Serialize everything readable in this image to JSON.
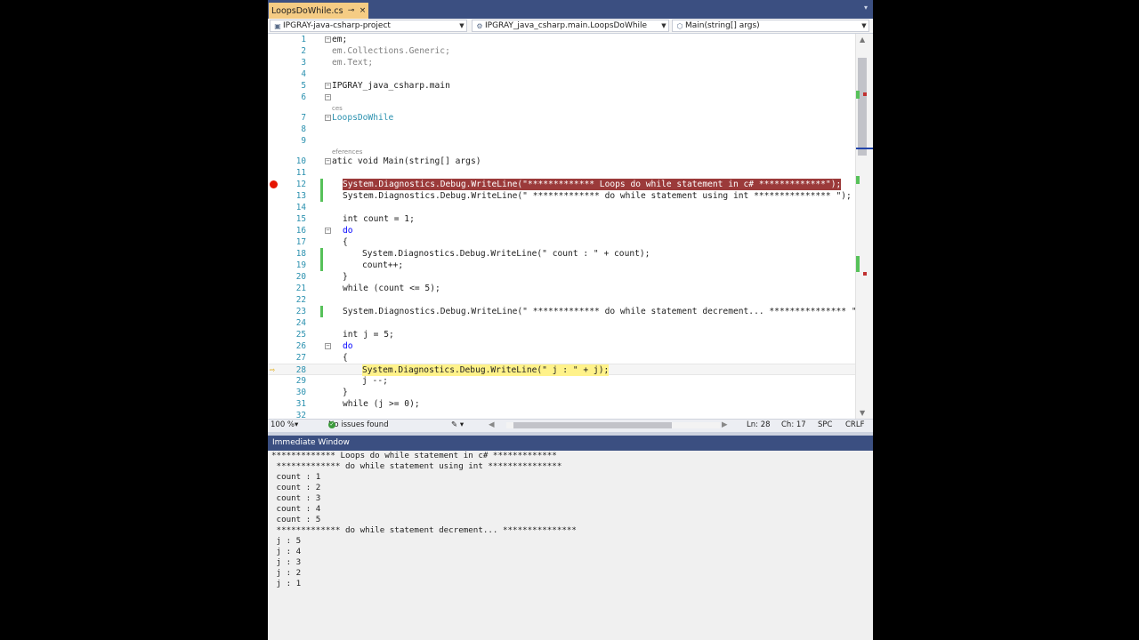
{
  "tab": {
    "label": "LoopsDoWhile.cs",
    "pin": "⊸",
    "close": "×",
    "overflow": "▾"
  },
  "navbar": {
    "project": "IPGRAY-java-csharp-project",
    "class": "IPGRAY_java_csharp.main.LoopsDoWhile",
    "method": "Main(string[] args)"
  },
  "editor": {
    "lines": [
      {
        "n": "1",
        "text": "em;"
      },
      {
        "n": "2",
        "text": "em.Collections.Generic;"
      },
      {
        "n": "3",
        "text": "em.Text;"
      },
      {
        "n": "4",
        "text": ""
      },
      {
        "n": "5",
        "text": "IPGRAY_java_csharp.main"
      },
      {
        "n": "6",
        "text": ""
      },
      {
        "n": "7",
        "text": "LoopsDoWhile",
        "ref": "ces"
      },
      {
        "n": "8",
        "text": ""
      },
      {
        "n": "9",
        "text": ""
      },
      {
        "n": "10",
        "text": "atic void Main(string[] args)",
        "ref": "eferences"
      },
      {
        "n": "11",
        "text": ""
      },
      {
        "n": "12",
        "text": "System.Diagnostics.Debug.WriteLine(\"************* Loops do while statement in c# *************\");"
      },
      {
        "n": "13",
        "text": "System.Diagnostics.Debug.WriteLine(\" ************* do while statement using int *************** \");"
      },
      {
        "n": "14",
        "text": ""
      },
      {
        "n": "15",
        "text": "int count = 1;"
      },
      {
        "n": "16",
        "text": "do"
      },
      {
        "n": "17",
        "text": "{"
      },
      {
        "n": "18",
        "text": "System.Diagnostics.Debug.WriteLine(\" count : \" + count);"
      },
      {
        "n": "19",
        "text": "count++;"
      },
      {
        "n": "20",
        "text": "}"
      },
      {
        "n": "21",
        "text": "while (count <= 5);"
      },
      {
        "n": "22",
        "text": ""
      },
      {
        "n": "23",
        "text": "System.Diagnostics.Debug.WriteLine(\" ************* do while statement decrement... *************** \");"
      },
      {
        "n": "24",
        "text": ""
      },
      {
        "n": "25",
        "text": "int j = 5;"
      },
      {
        "n": "26",
        "text": "do"
      },
      {
        "n": "27",
        "text": "{"
      },
      {
        "n": "28",
        "text": "System.Diagnostics.Debug.WriteLine(\" j : \" + j);"
      },
      {
        "n": "29",
        "text": "j --;"
      },
      {
        "n": "30",
        "text": "}"
      },
      {
        "n": "31",
        "text": "while (j >= 0);"
      },
      {
        "n": "32",
        "text": ""
      }
    ]
  },
  "status": {
    "zoom": "100 %",
    "issues": "No issues found",
    "ln": "Ln: 28",
    "ch": "Ch: 17",
    "spc": "SPC",
    "crlf": "CRLF"
  },
  "immediate": {
    "title": "Immediate Window",
    "output": [
      "************* Loops do while statement in c# *************",
      " ************* do while statement using int *************** ",
      " count : 1",
      " count : 2",
      " count : 3",
      " count : 4",
      " count : 5",
      " ************* do while statement decrement... *************** ",
      " j : 5",
      " j : 4",
      " j : 3",
      " j : 2",
      " j : 1"
    ]
  },
  "colors": {
    "tab_active": "#f5cc84",
    "title_bar": "#3b4f81",
    "breakpoint": "#e51400",
    "current_line": "#fff28a",
    "keyword": "#0000ff",
    "string": "#a31515",
    "type": "#2b91af"
  }
}
